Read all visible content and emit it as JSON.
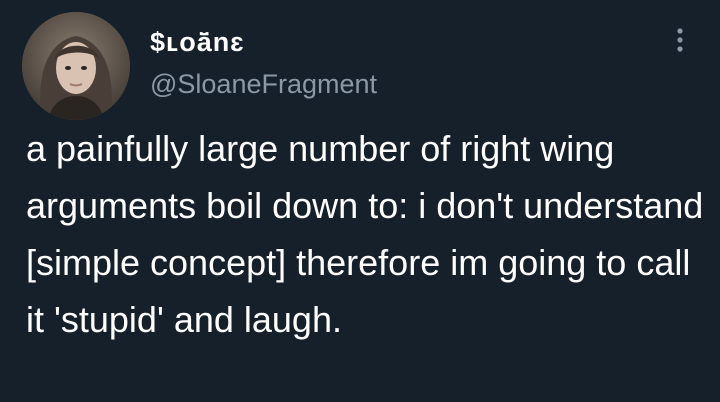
{
  "tweet": {
    "author": {
      "display_name": "$ʟoā̈nɛ",
      "handle": "@SloaneFragment"
    },
    "text": "a painfully large number of right wing arguments boil down to: i don't understand [simple concept] therefore im going to call it 'stupid' and laugh."
  },
  "icons": {
    "more": "more-vertical-icon"
  },
  "colors": {
    "background": "#16202b",
    "primary_text": "#ffffff",
    "secondary_text": "#8b98a5"
  }
}
